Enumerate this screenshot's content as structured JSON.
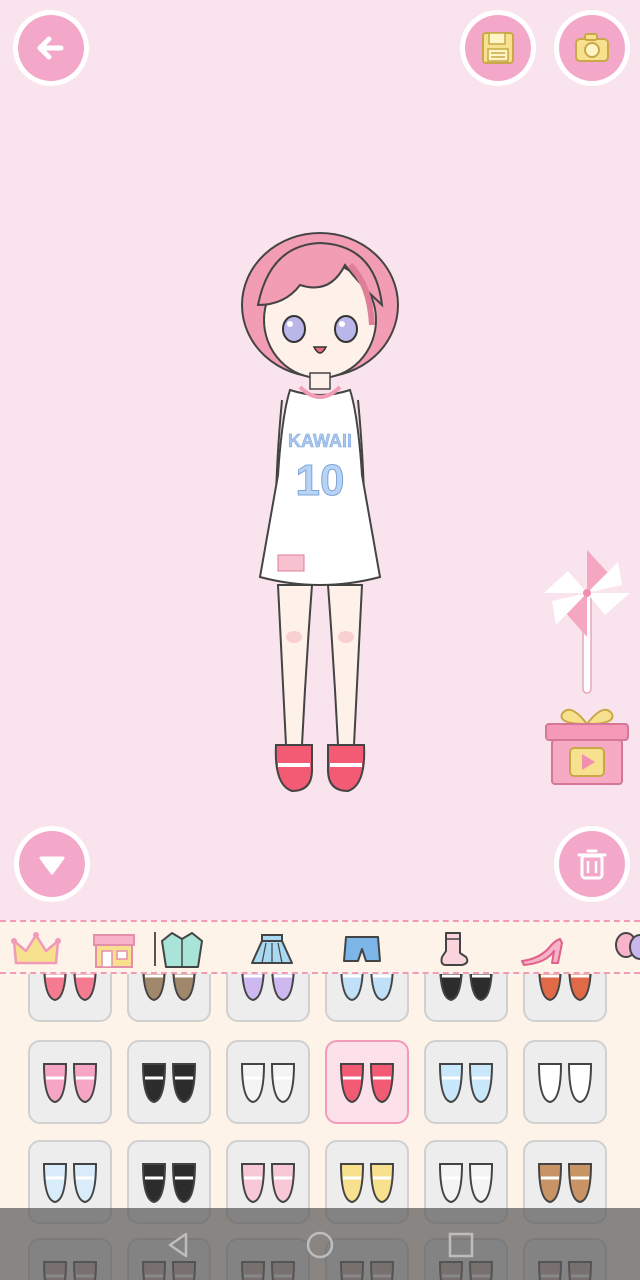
{
  "toolbar": {
    "back_icon": "arrow-left-icon",
    "save_icon": "floppy-disk-icon",
    "camera_icon": "camera-icon",
    "collapse_icon": "triangle-down-icon",
    "trash_icon": "trash-can-icon"
  },
  "character": {
    "jersey_text": "KAWAII",
    "jersey_number": "10"
  },
  "side_widgets": {
    "pinwheel_icon": "pinwheel-icon",
    "gift_icon": "gift-video-reward-icon"
  },
  "categories": [
    {
      "name": "premium",
      "icon": "crown-icon",
      "selected": false
    },
    {
      "name": "shop",
      "icon": "store-icon",
      "selected": false
    },
    {
      "name": "jacket",
      "icon": "jacket-icon",
      "selected": false
    },
    {
      "name": "skirt",
      "icon": "skirt-icon",
      "selected": false
    },
    {
      "name": "shorts",
      "icon": "shorts-icon",
      "selected": false
    },
    {
      "name": "socks",
      "icon": "sock-icon",
      "selected": false
    },
    {
      "name": "shoes",
      "icon": "high-heel-icon",
      "selected": true
    },
    {
      "name": "accessories",
      "icon": "balloon-icon",
      "selected": false
    }
  ],
  "items": [
    {
      "icon": "pink-flats-icon",
      "selected": false
    },
    {
      "icon": "brown-boots-icon",
      "selected": false
    },
    {
      "icon": "lavender-flats-icon",
      "selected": false
    },
    {
      "icon": "blue-sneakers-icon",
      "selected": false
    },
    {
      "icon": "black-shoes-icon",
      "selected": false
    },
    {
      "icon": "red-boots-icon",
      "selected": false
    },
    {
      "icon": "bunny-slippers-icon",
      "selected": false
    },
    {
      "icon": "black-punk-boots-icon",
      "selected": false
    },
    {
      "icon": "strappy-sandals-icon",
      "selected": false
    },
    {
      "icon": "mary-jane-flats-icon",
      "selected": true
    },
    {
      "icon": "blue-fluffy-slippers-icon",
      "selected": false
    },
    {
      "icon": "cat-slippers-icon",
      "selected": false
    },
    {
      "icon": "polka-dot-sneakers-icon",
      "selected": false
    },
    {
      "icon": "bow-platform-shoes-icon",
      "selected": false
    },
    {
      "icon": "ballet-slippers-icon",
      "selected": false
    },
    {
      "icon": "yellow-boots-icon",
      "selected": false
    },
    {
      "icon": "green-ribbon-boots-icon",
      "selected": false
    },
    {
      "icon": "flower-sandals-icon",
      "selected": false
    },
    {
      "icon": "partial-item-icon",
      "selected": false
    },
    {
      "icon": "partial-item-icon",
      "selected": false
    },
    {
      "icon": "partial-item-icon",
      "selected": false
    },
    {
      "icon": "partial-item-icon",
      "selected": false
    },
    {
      "icon": "partial-item-icon",
      "selected": false
    },
    {
      "icon": "partial-item-icon",
      "selected": false
    }
  ],
  "system_nav": {
    "back_icon": "nav-back-triangle-icon",
    "home_icon": "nav-home-circle-icon",
    "recents_icon": "nav-recents-square-icon"
  }
}
